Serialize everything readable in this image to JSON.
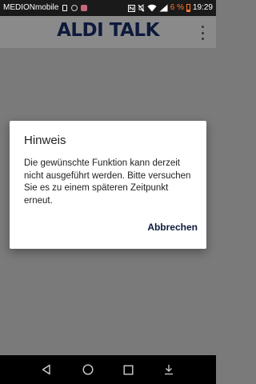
{
  "status_bar": {
    "carrier": "MEDIONmobile",
    "battery_percent": "6 %",
    "time": "19:29",
    "icons": [
      "sim-icon",
      "settings-icon",
      "app-notification-icon",
      "nfc-icon",
      "mute-icon",
      "wifi-icon",
      "signal-icon",
      "battery-icon"
    ]
  },
  "app_bar": {
    "brand": "ALDI TALK",
    "menu_icon": "overflow-menu-icon"
  },
  "dialog": {
    "title": "Hinweis",
    "message": "Die gewünschte Funktion kann derzeit nicht ausgeführt werden. Bitte versuchen Sie es zu einem späteren Zeitpunkt erneut.",
    "button_label": "Abbrechen"
  },
  "nav_bar": {
    "icons": [
      "back-icon",
      "home-icon",
      "recents-icon",
      "notification-pull-icon"
    ]
  },
  "colors": {
    "brand": "#0d1a3c",
    "scrim": "#7a7a7a",
    "battery_low": "#ff7a2a"
  }
}
